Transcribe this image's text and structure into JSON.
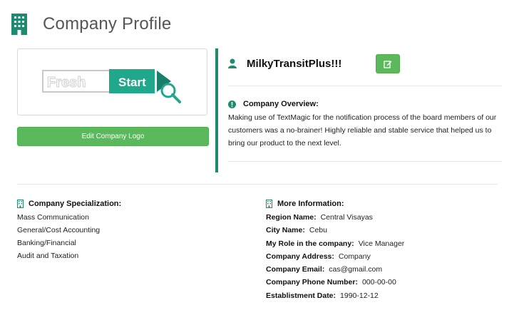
{
  "header": {
    "title": "Company Profile"
  },
  "logo": {
    "fresh_text": "Fresh",
    "start_text": "Start",
    "edit_button_label": "Edit Company Logo"
  },
  "profile": {
    "company_name": "MilkyTransitPlus!!!",
    "overview_heading": "Company Overview:",
    "overview_text": "Making use of TextMagic for the notification process of the board members of our customers was a no-brainer! Highly reliable and stable service that helped us to bring our product to the next level."
  },
  "specialization": {
    "title": "Company Specialization:",
    "items": [
      "Mass Communication",
      "General/Cost Accounting",
      "Banking/Financial",
      "Audit and Taxation"
    ]
  },
  "more_info": {
    "title": "More Information:",
    "rows": [
      {
        "label": "Region Name:",
        "value": "Central Visayas"
      },
      {
        "label": "City Name:",
        "value": "Cebu"
      },
      {
        "label": "My Role in the company:",
        "value": "Vice Manager"
      },
      {
        "label": "Company Address:",
        "value": "Company"
      },
      {
        "label": "Company Email:",
        "value": "cas@gmail.com"
      },
      {
        "label": "Company Phone Number:",
        "value": "000-00-00"
      },
      {
        "label": "Establistment Date:",
        "value": "1990-12-12"
      }
    ]
  },
  "colors": {
    "teal_accent": "#1f8a70",
    "green_button": "#5cb85c",
    "logo_teal": "#1fa88b"
  },
  "icons": {
    "header": "building-icon",
    "company_name": "user-icon",
    "edit_profile": "edit-icon",
    "overview": "exclamation-circle-icon",
    "section": "building-icon"
  }
}
